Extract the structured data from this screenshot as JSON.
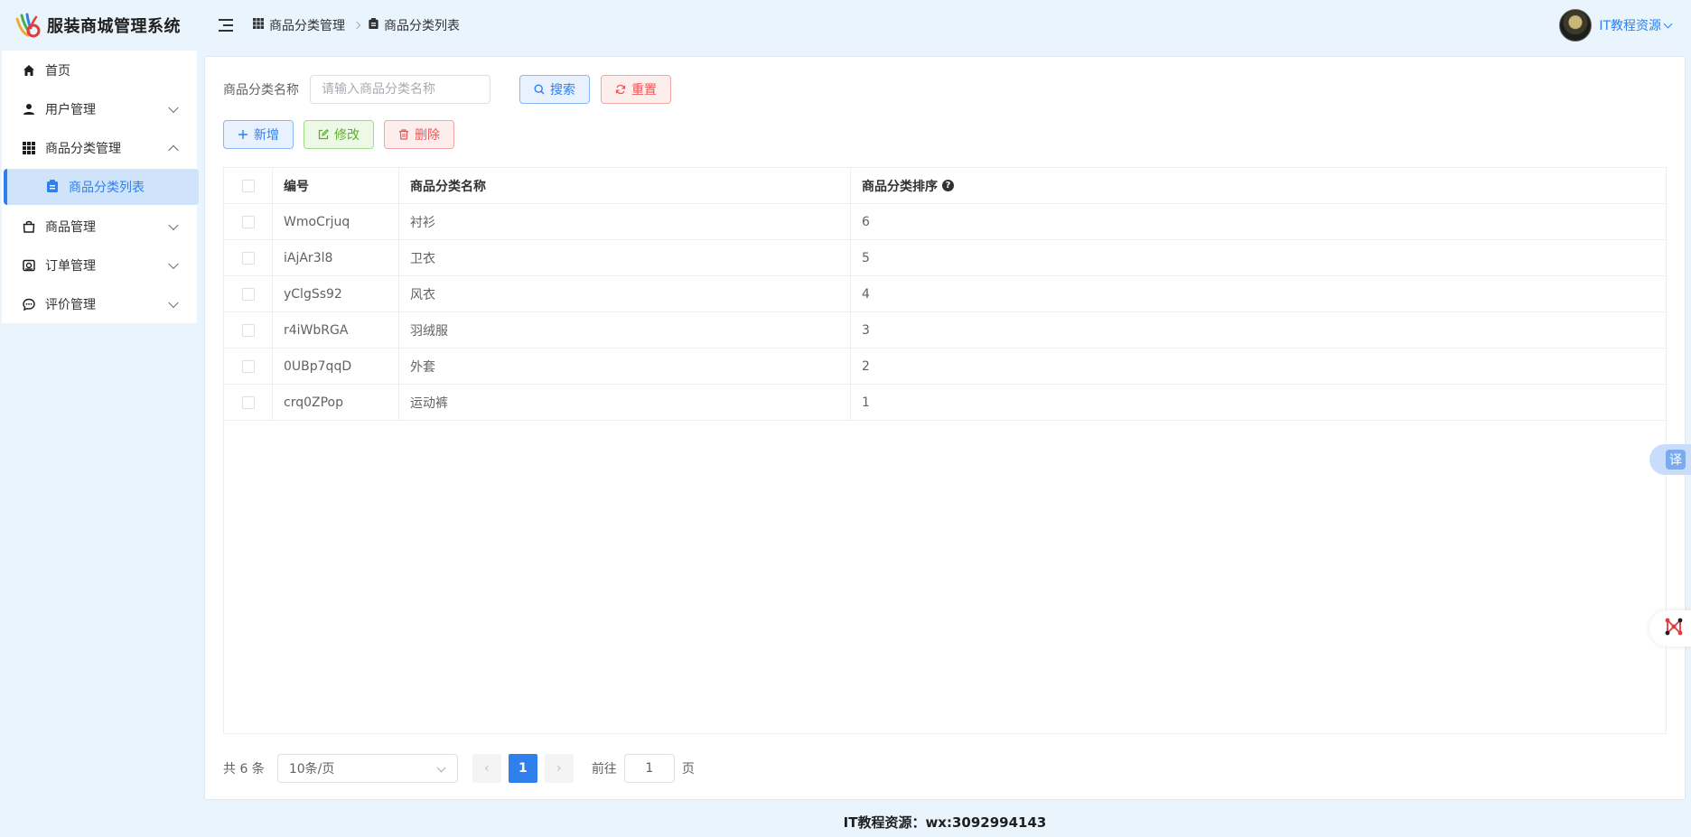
{
  "app": {
    "title": "服装商城管理系统"
  },
  "sidebar": {
    "items": [
      {
        "label": "首页",
        "icon": "home-icon"
      },
      {
        "label": "用户管理",
        "icon": "user-icon"
      },
      {
        "label": "商品分类管理",
        "icon": "grid-icon",
        "expanded": true
      },
      {
        "label": "商品分类列表",
        "icon": "clipboard-icon",
        "active": true
      },
      {
        "label": "商品管理",
        "icon": "bag-icon"
      },
      {
        "label": "订单管理",
        "icon": "order-icon"
      },
      {
        "label": "评价管理",
        "icon": "chat-icon"
      }
    ]
  },
  "header": {
    "breadcrumb": [
      "商品分类管理",
      "商品分类列表"
    ],
    "user_name": "IT教程资源"
  },
  "search": {
    "label": "商品分类名称",
    "placeholder": "请输入商品分类名称",
    "search_label": "搜索",
    "reset_label": "重置"
  },
  "toolbar": {
    "add_label": "新增",
    "edit_label": "修改",
    "delete_label": "删除"
  },
  "table": {
    "headers": {
      "id": "编号",
      "name": "商品分类名称",
      "sort": "商品分类排序"
    },
    "rows": [
      {
        "id": "WmoCrjuq",
        "name": "衬衫",
        "sort": "6"
      },
      {
        "id": "iAjAr3l8",
        "name": "卫衣",
        "sort": "5"
      },
      {
        "id": "yClgSs92",
        "name": "风衣",
        "sort": "4"
      },
      {
        "id": "r4iWbRGA",
        "name": "羽绒服",
        "sort": "3"
      },
      {
        "id": "0UBp7qqD",
        "name": "外套",
        "sort": "2"
      },
      {
        "id": "crq0ZPop",
        "name": "运动裤",
        "sort": "1"
      }
    ]
  },
  "pagination": {
    "total": "共 6 条",
    "page_size": "10条/页",
    "current_page": "1",
    "goto_prefix": "前往",
    "goto_value": "1",
    "goto_suffix": "页"
  },
  "footer": {
    "text": "IT教程资源：wx:3092994143"
  },
  "floating": {
    "translate_label": "译"
  },
  "colors": {
    "accent": "#2f80ed",
    "danger": "#f05656",
    "success": "#5cb030",
    "background": "#eaf4fd"
  }
}
